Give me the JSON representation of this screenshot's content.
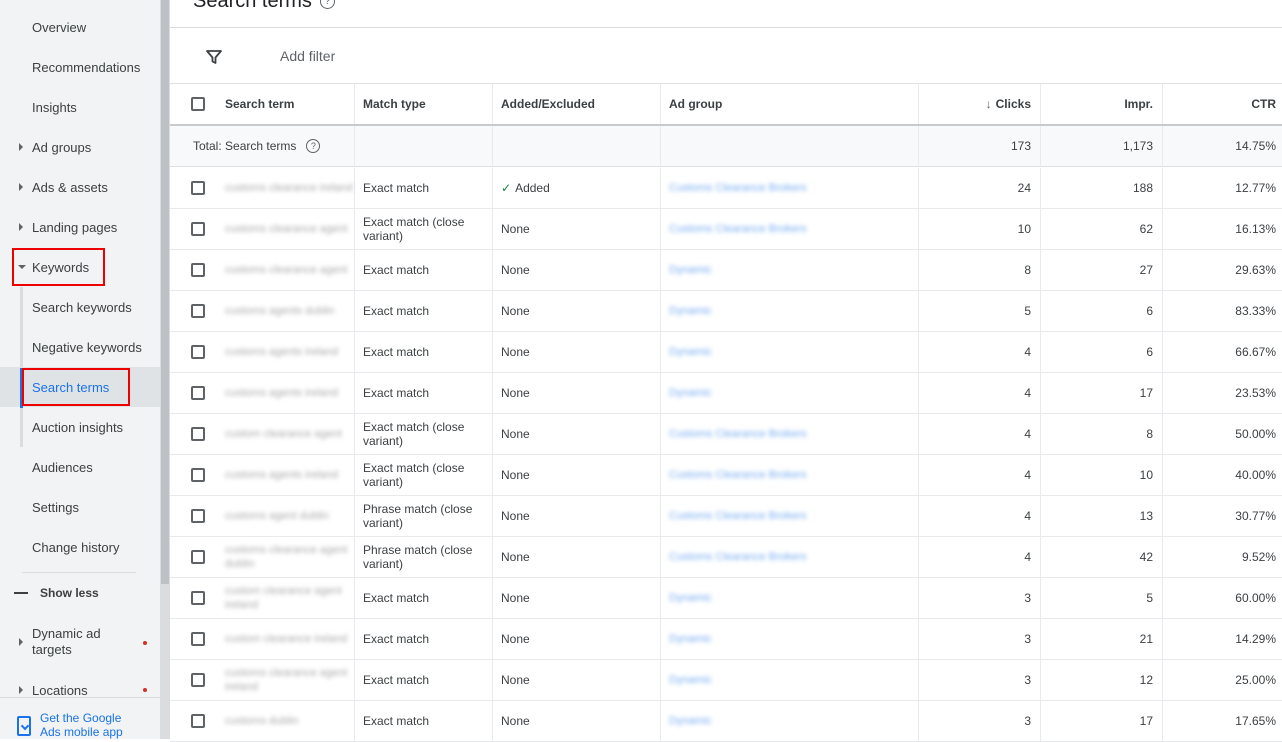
{
  "sidebar": {
    "items": [
      {
        "label": "Overview"
      },
      {
        "label": "Recommendations"
      },
      {
        "label": "Insights"
      },
      {
        "label": "Ad groups"
      },
      {
        "label": "Ads & assets"
      },
      {
        "label": "Landing pages"
      },
      {
        "label": "Keywords"
      },
      {
        "label": "Search keywords"
      },
      {
        "label": "Negative keywords"
      },
      {
        "label": "Search terms"
      },
      {
        "label": "Auction insights"
      },
      {
        "label": "Audiences"
      },
      {
        "label": "Settings"
      },
      {
        "label": "Change history"
      },
      {
        "label": "Dynamic ad targets"
      },
      {
        "label": "Locations"
      }
    ],
    "show_less": "Show less",
    "mobile_app": "Get the Google Ads mobile app"
  },
  "page": {
    "title": "Search terms",
    "add_filter": "Add filter"
  },
  "table": {
    "headers": {
      "term": "Search term",
      "match": "Match type",
      "added": "Added/Excluded",
      "group": "Ad group",
      "clicks": "Clicks",
      "impr": "Impr.",
      "ctr": "CTR"
    },
    "total": {
      "label": "Total: Search terms",
      "clicks": "173",
      "impr": "1,173",
      "ctr": "14.75%"
    },
    "rows": [
      {
        "term": "customs clearance ireland",
        "match": "Exact match",
        "added": "Added",
        "group": "Customs Clearance Brokers",
        "clicks": "24",
        "impr": "188",
        "ctr": "12.77%"
      },
      {
        "term": "customs clearance agent",
        "match": "Exact match (close variant)",
        "added": "None",
        "group": "Customs Clearance Brokers",
        "clicks": "10",
        "impr": "62",
        "ctr": "16.13%"
      },
      {
        "term": "customs clearance agent",
        "match": "Exact match",
        "added": "None",
        "group": "Dynamic",
        "clicks": "8",
        "impr": "27",
        "ctr": "29.63%"
      },
      {
        "term": "customs agents dublin",
        "match": "Exact match",
        "added": "None",
        "group": "Dynamic",
        "clicks": "5",
        "impr": "6",
        "ctr": "83.33%"
      },
      {
        "term": "customs agents ireland",
        "match": "Exact match",
        "added": "None",
        "group": "Dynamic",
        "clicks": "4",
        "impr": "6",
        "ctr": "66.67%"
      },
      {
        "term": "customs agents ireland",
        "match": "Exact match",
        "added": "None",
        "group": "Dynamic",
        "clicks": "4",
        "impr": "17",
        "ctr": "23.53%"
      },
      {
        "term": "custom clearance agent",
        "match": "Exact match (close variant)",
        "added": "None",
        "group": "Customs Clearance Brokers",
        "clicks": "4",
        "impr": "8",
        "ctr": "50.00%"
      },
      {
        "term": "customs agents ireland",
        "match": "Exact match (close variant)",
        "added": "None",
        "group": "Customs Clearance Brokers",
        "clicks": "4",
        "impr": "10",
        "ctr": "40.00%"
      },
      {
        "term": "customs agent dublin",
        "match": "Phrase match (close variant)",
        "added": "None",
        "group": "Customs Clearance Brokers",
        "clicks": "4",
        "impr": "13",
        "ctr": "30.77%"
      },
      {
        "term": "customs clearance agent dublin",
        "match": "Phrase match (close variant)",
        "added": "None",
        "group": "Customs Clearance Brokers",
        "clicks": "4",
        "impr": "42",
        "ctr": "9.52%"
      },
      {
        "term": "custom clearance agent ireland",
        "match": "Exact match",
        "added": "None",
        "group": "Dynamic",
        "clicks": "3",
        "impr": "5",
        "ctr": "60.00%"
      },
      {
        "term": "custom clearance ireland",
        "match": "Exact match",
        "added": "None",
        "group": "Dynamic",
        "clicks": "3",
        "impr": "21",
        "ctr": "14.29%"
      },
      {
        "term": "customs clearance agent ireland",
        "match": "Exact match",
        "added": "None",
        "group": "Dynamic",
        "clicks": "3",
        "impr": "12",
        "ctr": "25.00%"
      },
      {
        "term": "customs dublin",
        "match": "Exact match",
        "added": "None",
        "group": "Dynamic",
        "clicks": "3",
        "impr": "17",
        "ctr": "17.65%"
      }
    ]
  }
}
